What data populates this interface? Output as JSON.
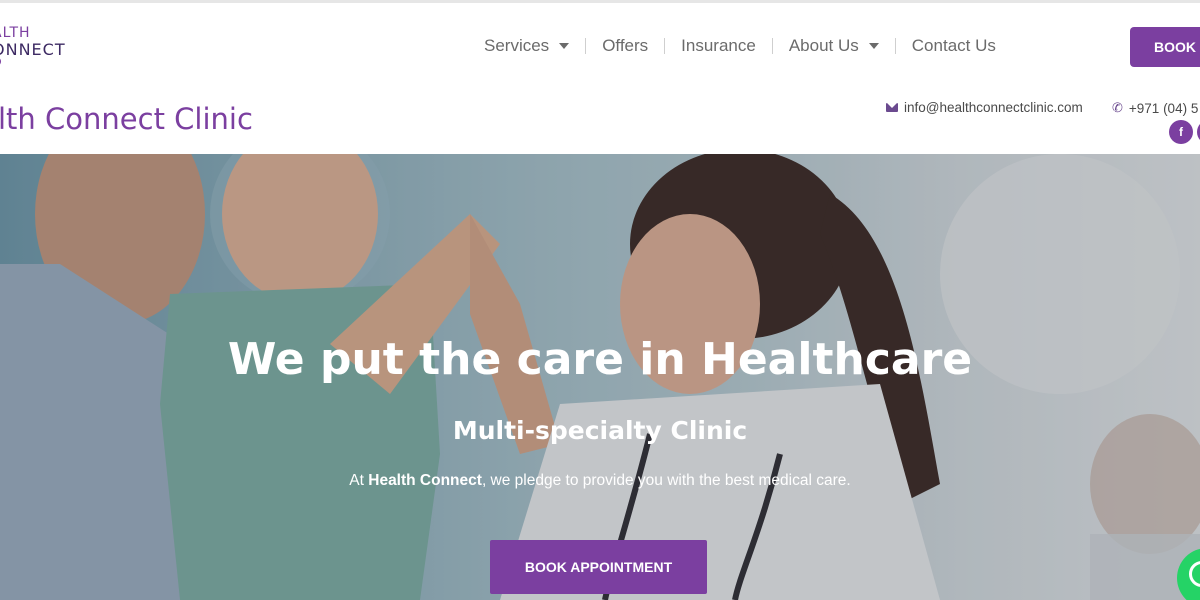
{
  "brand": {
    "logo_line1": "ALTH",
    "logo_line2": "ONNECT",
    "clinic_name": "lth Connect Clinic"
  },
  "nav": {
    "items": [
      {
        "label": "Services",
        "dropdown": true
      },
      {
        "label": "Offers",
        "dropdown": false
      },
      {
        "label": "Insurance",
        "dropdown": false
      },
      {
        "label": "About Us",
        "dropdown": true
      },
      {
        "label": "Contact Us",
        "dropdown": false
      }
    ],
    "book_button": "BOOK N"
  },
  "contact": {
    "email": "info@healthconnectclinic.com",
    "phone": "+971 (04) 5"
  },
  "social": {
    "icons": [
      "facebook-icon",
      "social-icon"
    ]
  },
  "hero": {
    "title": "We put the care in Healthcare",
    "subtitle": "Multi-specialty Clinic",
    "text_prefix": "At ",
    "text_brand": "Health Connect",
    "text_suffix": ", we pledge to provide you with the best medical care.",
    "button": "BOOK APPOINTMENT"
  },
  "colors": {
    "accent": "#7b3fa0",
    "whatsapp": "#25d366"
  }
}
